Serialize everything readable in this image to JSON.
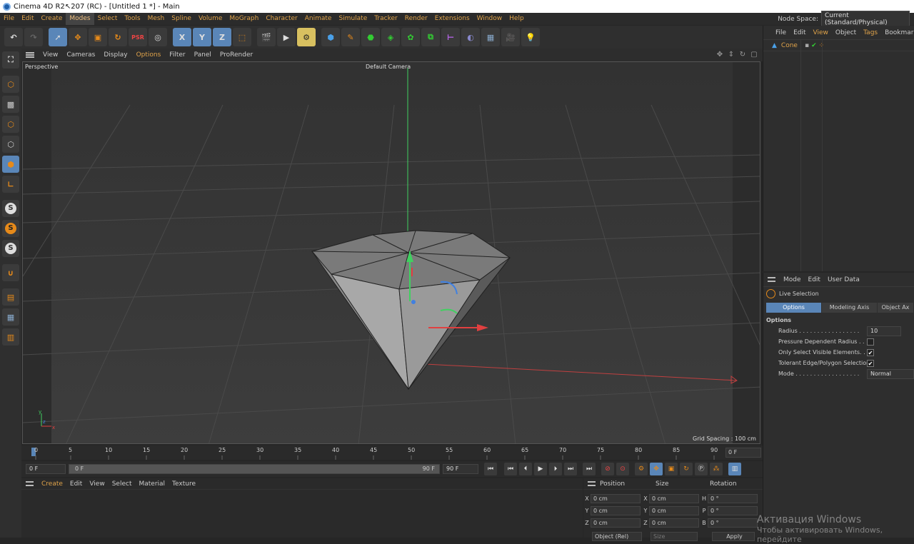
{
  "window": {
    "title": "Cinema 4D R2↖207 (RC) - [Untitled 1 *] - Main"
  },
  "menubar": {
    "items": [
      "File",
      "Edit",
      "Create",
      "Modes",
      "Select",
      "Tools",
      "Mesh",
      "Spline",
      "Volume",
      "MoGraph",
      "Character",
      "Animate",
      "Simulate",
      "Tracker",
      "Render",
      "Extensions",
      "Window",
      "Help"
    ],
    "node_space_label": "Node Space:",
    "node_space_value": "Current (Standard/Physical)"
  },
  "viewport": {
    "menu": [
      "View",
      "Cameras",
      "Display",
      "Options",
      "Filter",
      "Panel",
      "ProRender"
    ],
    "projection": "Perspective",
    "camera": "Default Camera",
    "grid_spacing": "Grid Spacing : 100 cm"
  },
  "timeline": {
    "ticks": [
      "0",
      "5",
      "10",
      "15",
      "20",
      "25",
      "30",
      "35",
      "40",
      "45",
      "50",
      "55",
      "60",
      "65",
      "70",
      "75",
      "80",
      "85",
      "90"
    ],
    "current_frame": "0 F",
    "start_field": "0 F",
    "range_start": "0 F",
    "range_end": "90 F",
    "end_field": "90 F"
  },
  "material": {
    "menu": [
      "Create",
      "Edit",
      "View",
      "Select",
      "Material",
      "Texture"
    ]
  },
  "coords": {
    "headers": [
      "Position",
      "Size",
      "Rotation"
    ],
    "rows": [
      {
        "p_axis": "X",
        "p": "0 cm",
        "s_axis": "X",
        "s": "0 cm",
        "r_axis": "H",
        "r": "0 °"
      },
      {
        "p_axis": "Y",
        "p": "0 cm",
        "s_axis": "Y",
        "s": "0 cm",
        "r_axis": "P",
        "r": "0 °"
      },
      {
        "p_axis": "Z",
        "p": "0 cm",
        "s_axis": "Z",
        "s": "0 cm",
        "r_axis": "B",
        "r": "0 °"
      }
    ],
    "mode_select": "Object (Rel)",
    "size_select": "Size",
    "apply": "Apply"
  },
  "object_manager": {
    "menu": [
      "File",
      "Edit",
      "View",
      "Object",
      "Tags",
      "Bookmarks"
    ],
    "objects": [
      {
        "name": "Cone"
      }
    ]
  },
  "attributes": {
    "menu": [
      "Mode",
      "Edit",
      "User Data"
    ],
    "tool_name": "Live Selection",
    "tabs": [
      "Options",
      "Modeling Axis",
      "Object Ax"
    ],
    "section": "Options",
    "radius_label": "Radius . . . . . . . . . . . . . . . . .",
    "radius_value": "10",
    "pressure_label": "Pressure Dependent Radius . . .",
    "visible_label": "Only Select Visible Elements. .",
    "tolerant_label": "Tolerant Edge/Polygon Selection",
    "mode_label": "Mode . . . . . . . . . . . . . . . . . .",
    "mode_value": "Normal"
  },
  "watermark": {
    "line1": "Активация Windows",
    "line2": "Чтобы активировать Windows, перейдите"
  },
  "colors": {
    "accent": "#e0a34a",
    "selected": "#5a86b8",
    "x_axis": "#e04040",
    "y_axis": "#40d060",
    "z_axis": "#4080e0"
  }
}
